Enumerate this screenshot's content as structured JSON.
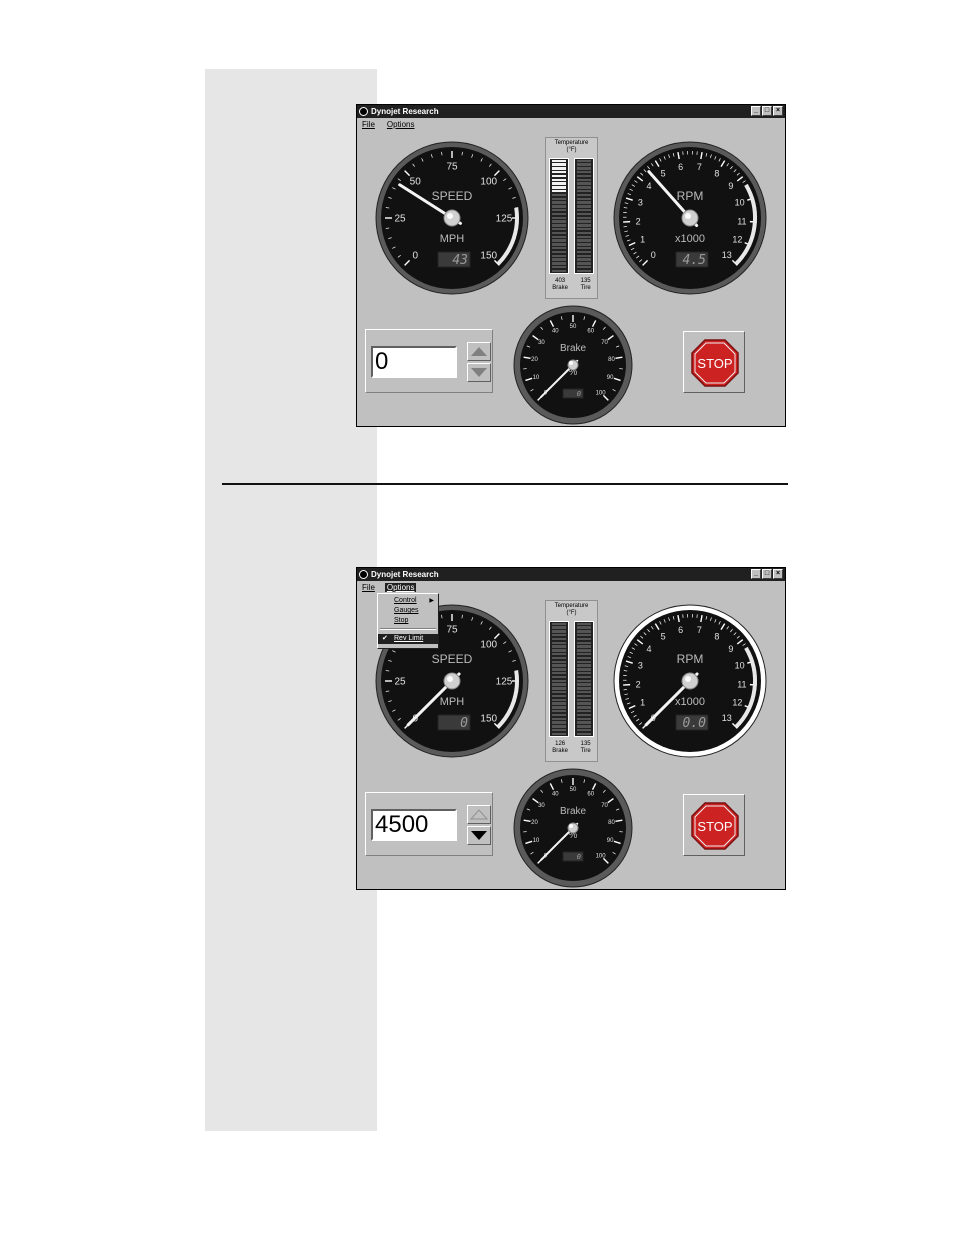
{
  "window_title": "Dynojet Research",
  "menus": [
    "File",
    "Options"
  ],
  "colors": {
    "titlebar": "#202020",
    "face": "#c0c0c0",
    "gauge_face": "#111111",
    "stop_red": "#cc2222"
  },
  "icons": {
    "system_menu": "app-icon",
    "minimize": "minimize-icon",
    "maximize": "maximize-icon",
    "close": "close-icon"
  },
  "options_menu_items": [
    {
      "label": "Control",
      "submenu": true,
      "checked": false
    },
    {
      "label": "Gauges",
      "submenu": false,
      "checked": false
    },
    {
      "label": "Stop",
      "submenu": false,
      "checked": false
    },
    {
      "label": "Rev Limit",
      "submenu": false,
      "checked": true
    }
  ],
  "screens": [
    {
      "menu_open": false,
      "speed": {
        "label": "SPEED",
        "unit": "MPH",
        "ticks": [
          "0",
          "25",
          "50",
          "75",
          "100",
          "125",
          "150"
        ],
        "value": 43,
        "max": 150,
        "readout": "43"
      },
      "rpm": {
        "label": "RPM",
        "unit": "x1000",
        "ticks": [
          "0",
          "1",
          "2",
          "3",
          "4",
          "5",
          "6",
          "7",
          "8",
          "9",
          "10",
          "11",
          "12",
          "13"
        ],
        "value": 4.5,
        "max": 13,
        "readout": "4.5",
        "highlighted": false
      },
      "temperature": {
        "title_line1": "Temperature",
        "title_line2": "(°F)",
        "brake_value": "403",
        "brake_label": "Brake",
        "tire_value": "135",
        "tire_label": "Tire",
        "brake_fill_fraction": 0.28,
        "tire_fill_fraction": 0.0
      },
      "brake": {
        "label": "Brake",
        "unit": "%",
        "ticks": [
          "0",
          "10",
          "20",
          "30",
          "40",
          "50",
          "60",
          "70",
          "80",
          "90",
          "100"
        ],
        "value": 0,
        "max": 100,
        "readout": "0"
      },
      "control_value": "0",
      "spin_up_enabled": true,
      "spin_down_enabled": true,
      "stop_label": "STOP"
    },
    {
      "menu_open": true,
      "speed": {
        "label": "SPEED",
        "unit": "MPH",
        "ticks": [
          "0",
          "25",
          "50",
          "75",
          "100",
          "125",
          "150"
        ],
        "value": 0,
        "max": 150,
        "readout": "0"
      },
      "rpm": {
        "label": "RPM",
        "unit": "x1000",
        "ticks": [
          "0",
          "1",
          "2",
          "3",
          "4",
          "5",
          "6",
          "7",
          "8",
          "9",
          "10",
          "11",
          "12",
          "13"
        ],
        "value": 0,
        "max": 13,
        "readout": "0.0",
        "highlighted": true
      },
      "temperature": {
        "title_line1": "Temperature",
        "title_line2": "(°F)",
        "brake_value": "126",
        "brake_label": "Brake",
        "tire_value": "135",
        "tire_label": "Tire",
        "brake_fill_fraction": 0.0,
        "tire_fill_fraction": 0.0
      },
      "brake": {
        "label": "Brake",
        "unit": "%",
        "ticks": [
          "0",
          "10",
          "20",
          "30",
          "40",
          "50",
          "60",
          "70",
          "80",
          "90",
          "100"
        ],
        "value": 0,
        "max": 100,
        "readout": "0"
      },
      "control_value": "4500",
      "spin_up_enabled": false,
      "spin_down_enabled": true,
      "stop_label": "STOP"
    }
  ]
}
